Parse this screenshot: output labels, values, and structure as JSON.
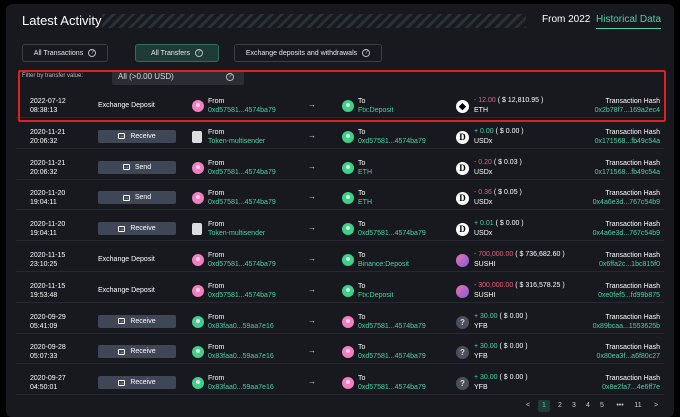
{
  "header": {
    "title": "Latest Activity",
    "period": "From 2022",
    "historical": "Historical Data"
  },
  "tabs": [
    {
      "label": "All Transactions",
      "active": false
    },
    {
      "label": "All Transfers",
      "active": true
    },
    {
      "label": "Exchange deposits and withdrawals",
      "active": false
    }
  ],
  "filter": {
    "label": "Filter by transfer value:",
    "value": "All (>0.00 USD)"
  },
  "rows": [
    {
      "date": "2022-07-12",
      "time": "08:38:13",
      "type": "Exchange Deposit",
      "type_style": "text",
      "from_label": "From",
      "from_addr": "0xd57581...4574ba79",
      "from_icon": "pink",
      "to_label": "To",
      "to_addr": "Ftx:Deposit",
      "to_icon": "green",
      "token": "eth",
      "amount": "- 12.00",
      "amount_sign": "neg",
      "usd": "( $ 12,810.95 )",
      "symbol": "ETH",
      "hash_label": "Transaction Hash",
      "hash": "0x2b78f7...169a2ec4"
    },
    {
      "date": "2020-11-21",
      "time": "20:06:32",
      "type": "Receive",
      "type_style": "button",
      "from_label": "From",
      "from_addr": "Token-multisender",
      "from_icon": "doc",
      "to_label": "To",
      "to_addr": "0xd57581...4574ba79",
      "to_icon": "green",
      "token": "usdx",
      "amount": "+ 0.00",
      "amount_sign": "pos",
      "usd": "( $ 0.00 )",
      "symbol": "USDx",
      "hash_label": "Transaction Hash",
      "hash": "0x171568...fb49c54a"
    },
    {
      "date": "2020-11-21",
      "time": "20:06:32",
      "type": "Send",
      "type_style": "button",
      "from_label": "From",
      "from_addr": "0xd57581...4574ba79",
      "from_icon": "pink",
      "to_label": "To",
      "to_addr": "ETH",
      "to_icon": "green",
      "token": "usdx",
      "amount": "- 0.20",
      "amount_sign": "neg",
      "usd": "( $ 0.03 )",
      "symbol": "USDx",
      "hash_label": "Transaction Hash",
      "hash": "0x171568...fb49c54a"
    },
    {
      "date": "2020-11-20",
      "time": "19:04:11",
      "type": "Send",
      "type_style": "button",
      "from_label": "From",
      "from_addr": "0xd57581...4574ba79",
      "from_icon": "pink",
      "to_label": "To",
      "to_addr": "ETH",
      "to_icon": "green",
      "token": "usdx",
      "amount": "- 0.36",
      "amount_sign": "neg",
      "usd": "( $ 0.05 )",
      "symbol": "USDx",
      "hash_label": "Transaction Hash",
      "hash": "0x4a6e3d...767c54b9"
    },
    {
      "date": "2020-11-20",
      "time": "19:04:11",
      "type": "Receive",
      "type_style": "button",
      "from_label": "From",
      "from_addr": "Token-multisender",
      "from_icon": "doc",
      "to_label": "To",
      "to_addr": "0xd57581...4574ba79",
      "to_icon": "green",
      "token": "usdx",
      "amount": "+ 0.01",
      "amount_sign": "pos",
      "usd": "( $ 0.00 )",
      "symbol": "USDx",
      "hash_label": "Transaction Hash",
      "hash": "0x4a6e3d...767c54b9"
    },
    {
      "date": "2020-11-15",
      "time": "23:10:25",
      "type": "Exchange Deposit",
      "type_style": "text",
      "from_label": "From",
      "from_addr": "0xd57581...4574ba79",
      "from_icon": "pink",
      "to_label": "To",
      "to_addr": "Binance:Deposit",
      "to_icon": "green",
      "token": "sushi",
      "amount": "- 700,000.00",
      "amount_sign": "neg",
      "usd": "( $ 736,682.60 )",
      "symbol": "SUSHI",
      "hash_label": "Transaction Hash",
      "hash": "0x6ffa2c...1bc815f0"
    },
    {
      "date": "2020-11-15",
      "time": "19:53:48",
      "type": "Exchange Deposit",
      "type_style": "text",
      "from_label": "From",
      "from_addr": "0xd57581...4574ba79",
      "from_icon": "pink",
      "to_label": "To",
      "to_addr": "Ftx:Deposit",
      "to_icon": "green",
      "token": "sushi",
      "amount": "- 300,000.00",
      "amount_sign": "neg",
      "usd": "( $ 316,578.25 )",
      "symbol": "SUSHI",
      "hash_label": "Transaction Hash",
      "hash": "0xe0fef5...fd99b875"
    },
    {
      "date": "2020-09-29",
      "time": "05:41:09",
      "type": "Receive",
      "type_style": "button",
      "from_label": "From",
      "from_addr": "0x83faa0...59aa7e16",
      "from_icon": "green",
      "to_label": "To",
      "to_addr": "0xd57581...4574ba79",
      "to_icon": "pink",
      "token": "yfb",
      "amount": "+ 30.00",
      "amount_sign": "pos",
      "usd": "( $ 0.00 )",
      "symbol": "YFB",
      "hash_label": "Transaction Hash",
      "hash": "0x89bcaa...1553625b"
    },
    {
      "date": "2020-09-28",
      "time": "05:07:33",
      "type": "Receive",
      "type_style": "button",
      "from_label": "From",
      "from_addr": "0x83faa0...59aa7e16",
      "from_icon": "green",
      "to_label": "To",
      "to_addr": "0xd57581...4574ba79",
      "to_icon": "pink",
      "token": "yfb",
      "amount": "+ 30.00",
      "amount_sign": "pos",
      "usd": "( $ 0.00 )",
      "symbol": "YFB",
      "hash_label": "Transaction Hash",
      "hash": "0x80ea3f...a6f80c27"
    },
    {
      "date": "2020-09-27",
      "time": "04:50:01",
      "type": "Receive",
      "type_style": "button",
      "from_label": "From",
      "from_addr": "0x83faa0...59aa7e16",
      "from_icon": "green",
      "to_label": "To",
      "to_addr": "0xd57581...4574ba79",
      "to_icon": "pink",
      "token": "yfb",
      "amount": "+ 30.00",
      "amount_sign": "pos",
      "usd": "( $ 0.00 )",
      "symbol": "YFB",
      "hash_label": "Transaction Hash",
      "hash": "0x8e2fa7...4e6ff7e"
    }
  ],
  "token_glyphs": {
    "eth": "◆",
    "usdx": "D",
    "sushi": "",
    "yfb": "?"
  },
  "pager": {
    "prev": "<",
    "pages": [
      "1",
      "2",
      "3",
      "4",
      "5"
    ],
    "ellipsis": "•••",
    "last": "11",
    "next": ">",
    "active": "1"
  },
  "highlight_color": "#e0201c",
  "accent_color": "#4ed2a4"
}
